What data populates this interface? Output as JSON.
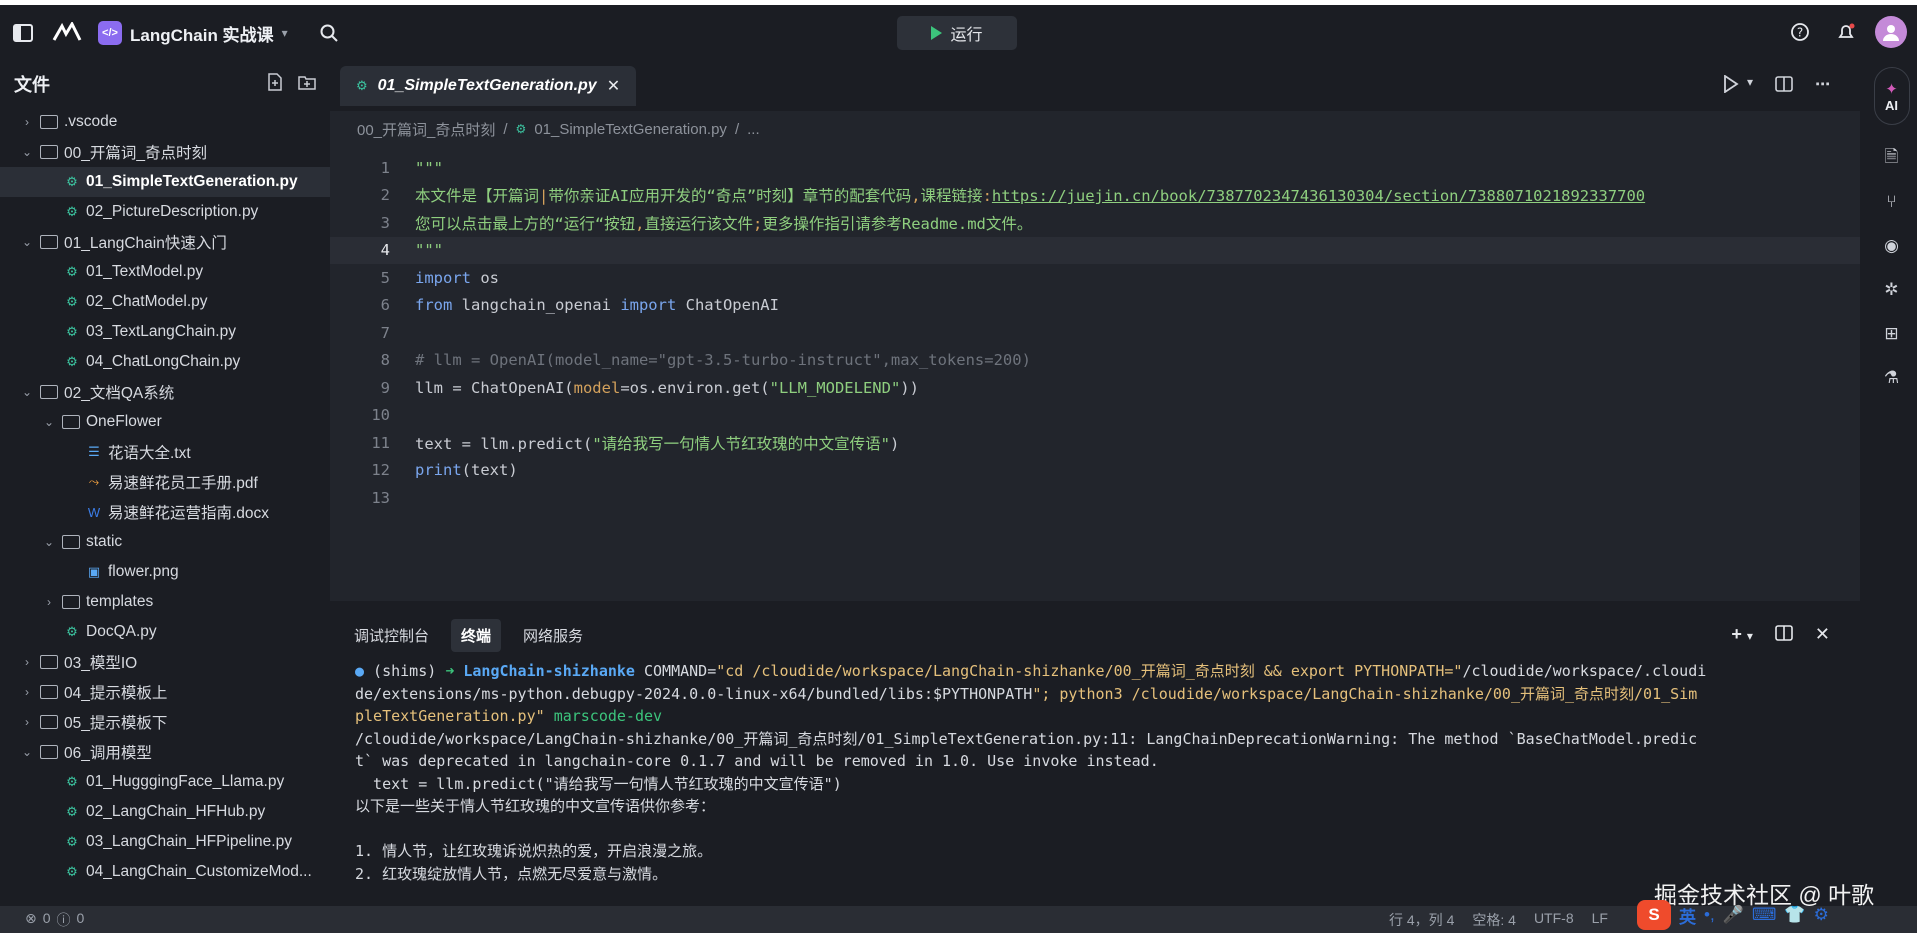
{
  "topbar": {
    "project_name": "LangChain 实战课",
    "run_label": "运行"
  },
  "sidebar": {
    "title": "文件",
    "tree": [
      {
        "label": ".vscode",
        "type": "folder",
        "depth": 0,
        "expanded": false
      },
      {
        "label": "00_开篇词_奇点时刻",
        "type": "folder",
        "depth": 0,
        "expanded": true
      },
      {
        "label": "01_SimpleTextGeneration.py",
        "type": "py",
        "depth": 1,
        "active": true
      },
      {
        "label": "02_PictureDescription.py",
        "type": "py",
        "depth": 1
      },
      {
        "label": "01_LangChain快速入门",
        "type": "folder",
        "depth": 0,
        "expanded": true
      },
      {
        "label": "01_TextModel.py",
        "type": "py",
        "depth": 1
      },
      {
        "label": "02_ChatModel.py",
        "type": "py",
        "depth": 1
      },
      {
        "label": "03_TextLangChain.py",
        "type": "py",
        "depth": 1
      },
      {
        "label": "04_ChatLongChain.py",
        "type": "py",
        "depth": 1
      },
      {
        "label": "02_文档QA系统",
        "type": "folder",
        "depth": 0,
        "expanded": true
      },
      {
        "label": "OneFlower",
        "type": "folder",
        "depth": 1,
        "expanded": true
      },
      {
        "label": "花语大全.txt",
        "type": "txt",
        "depth": 2
      },
      {
        "label": "易速鲜花员工手册.pdf",
        "type": "pdf",
        "depth": 2
      },
      {
        "label": "易速鲜花运营指南.docx",
        "type": "docx",
        "depth": 2
      },
      {
        "label": "static",
        "type": "folder",
        "depth": 1,
        "expanded": true
      },
      {
        "label": "flower.png",
        "type": "png",
        "depth": 2
      },
      {
        "label": "templates",
        "type": "folder",
        "depth": 1,
        "expanded": false
      },
      {
        "label": "DocQA.py",
        "type": "py",
        "depth": 1
      },
      {
        "label": "03_模型IO",
        "type": "folder",
        "depth": 0,
        "expanded": false
      },
      {
        "label": "04_提示模板上",
        "type": "folder",
        "depth": 0,
        "expanded": false
      },
      {
        "label": "05_提示模板下",
        "type": "folder",
        "depth": 0,
        "expanded": false
      },
      {
        "label": "06_调用模型",
        "type": "folder",
        "depth": 0,
        "expanded": true
      },
      {
        "label": "01_HugggingFace_Llama.py",
        "type": "py",
        "depth": 1
      },
      {
        "label": "02_LangChain_HFHub.py",
        "type": "py",
        "depth": 1
      },
      {
        "label": "03_LangChain_HFPipeline.py",
        "type": "py",
        "depth": 1
      },
      {
        "label": "04_LangChain_CustomizeMod...",
        "type": "py",
        "depth": 1
      }
    ]
  },
  "editor": {
    "tab_label": "01_SimpleTextGeneration.py",
    "breadcrumb": [
      "00_开篇词_奇点时刻",
      "01_SimpleTextGeneration.py",
      "..."
    ],
    "current_line": 4
  },
  "panel": {
    "tabs": [
      "调试控制台",
      "终端",
      "网络服务"
    ],
    "selected_tab": "终端"
  },
  "statusbar": {
    "errors": "0",
    "warnings": "0",
    "position": "行 4，列 4",
    "spaces": "空格: 4",
    "encoding": "UTF-8",
    "eol": "LF"
  },
  "overlay": {
    "watermark": "掘金技术社区 @ 叶歌",
    "ime_label": "英"
  },
  "rightbar": {
    "ai_label": "AI"
  },
  "colors": {
    "accent_run": "#3cc47c",
    "project_badge": "#8b6cf0",
    "string": "#8fcf7f",
    "keyword": "#7aa6ee"
  }
}
